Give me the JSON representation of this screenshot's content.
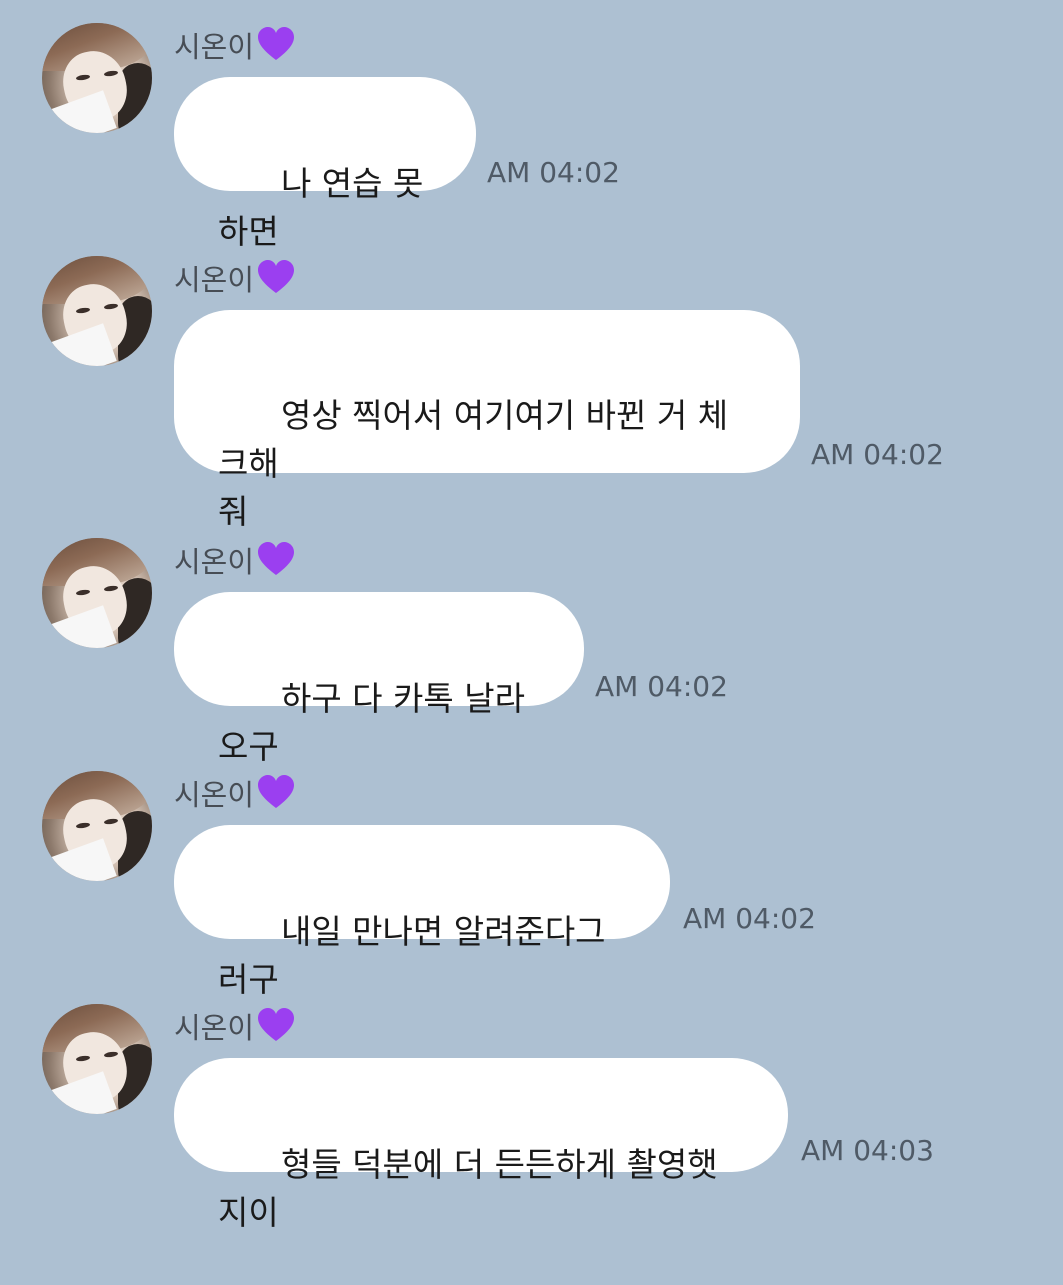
{
  "sender": {
    "name": "시온이",
    "heart_icon": "purple-heart-icon",
    "heart_color": "#9b3ff0"
  },
  "background_color": "#adc0d2",
  "messages": [
    {
      "text": "나 연습 못하면",
      "time": "AM 04:02"
    },
    {
      "text": "영상 찍어서 여기여기 바뀐 거 체크해\n줘",
      "time": "AM 04:02"
    },
    {
      "text": "하구 다 카톡 날라오구",
      "time": "AM 04:02"
    },
    {
      "text": "내일 만나면 알려준다그러구",
      "time": "AM 04:02"
    },
    {
      "text": "형들 덕분에 더 든든하게 촬영햇지이",
      "time": "AM 04:03"
    }
  ]
}
